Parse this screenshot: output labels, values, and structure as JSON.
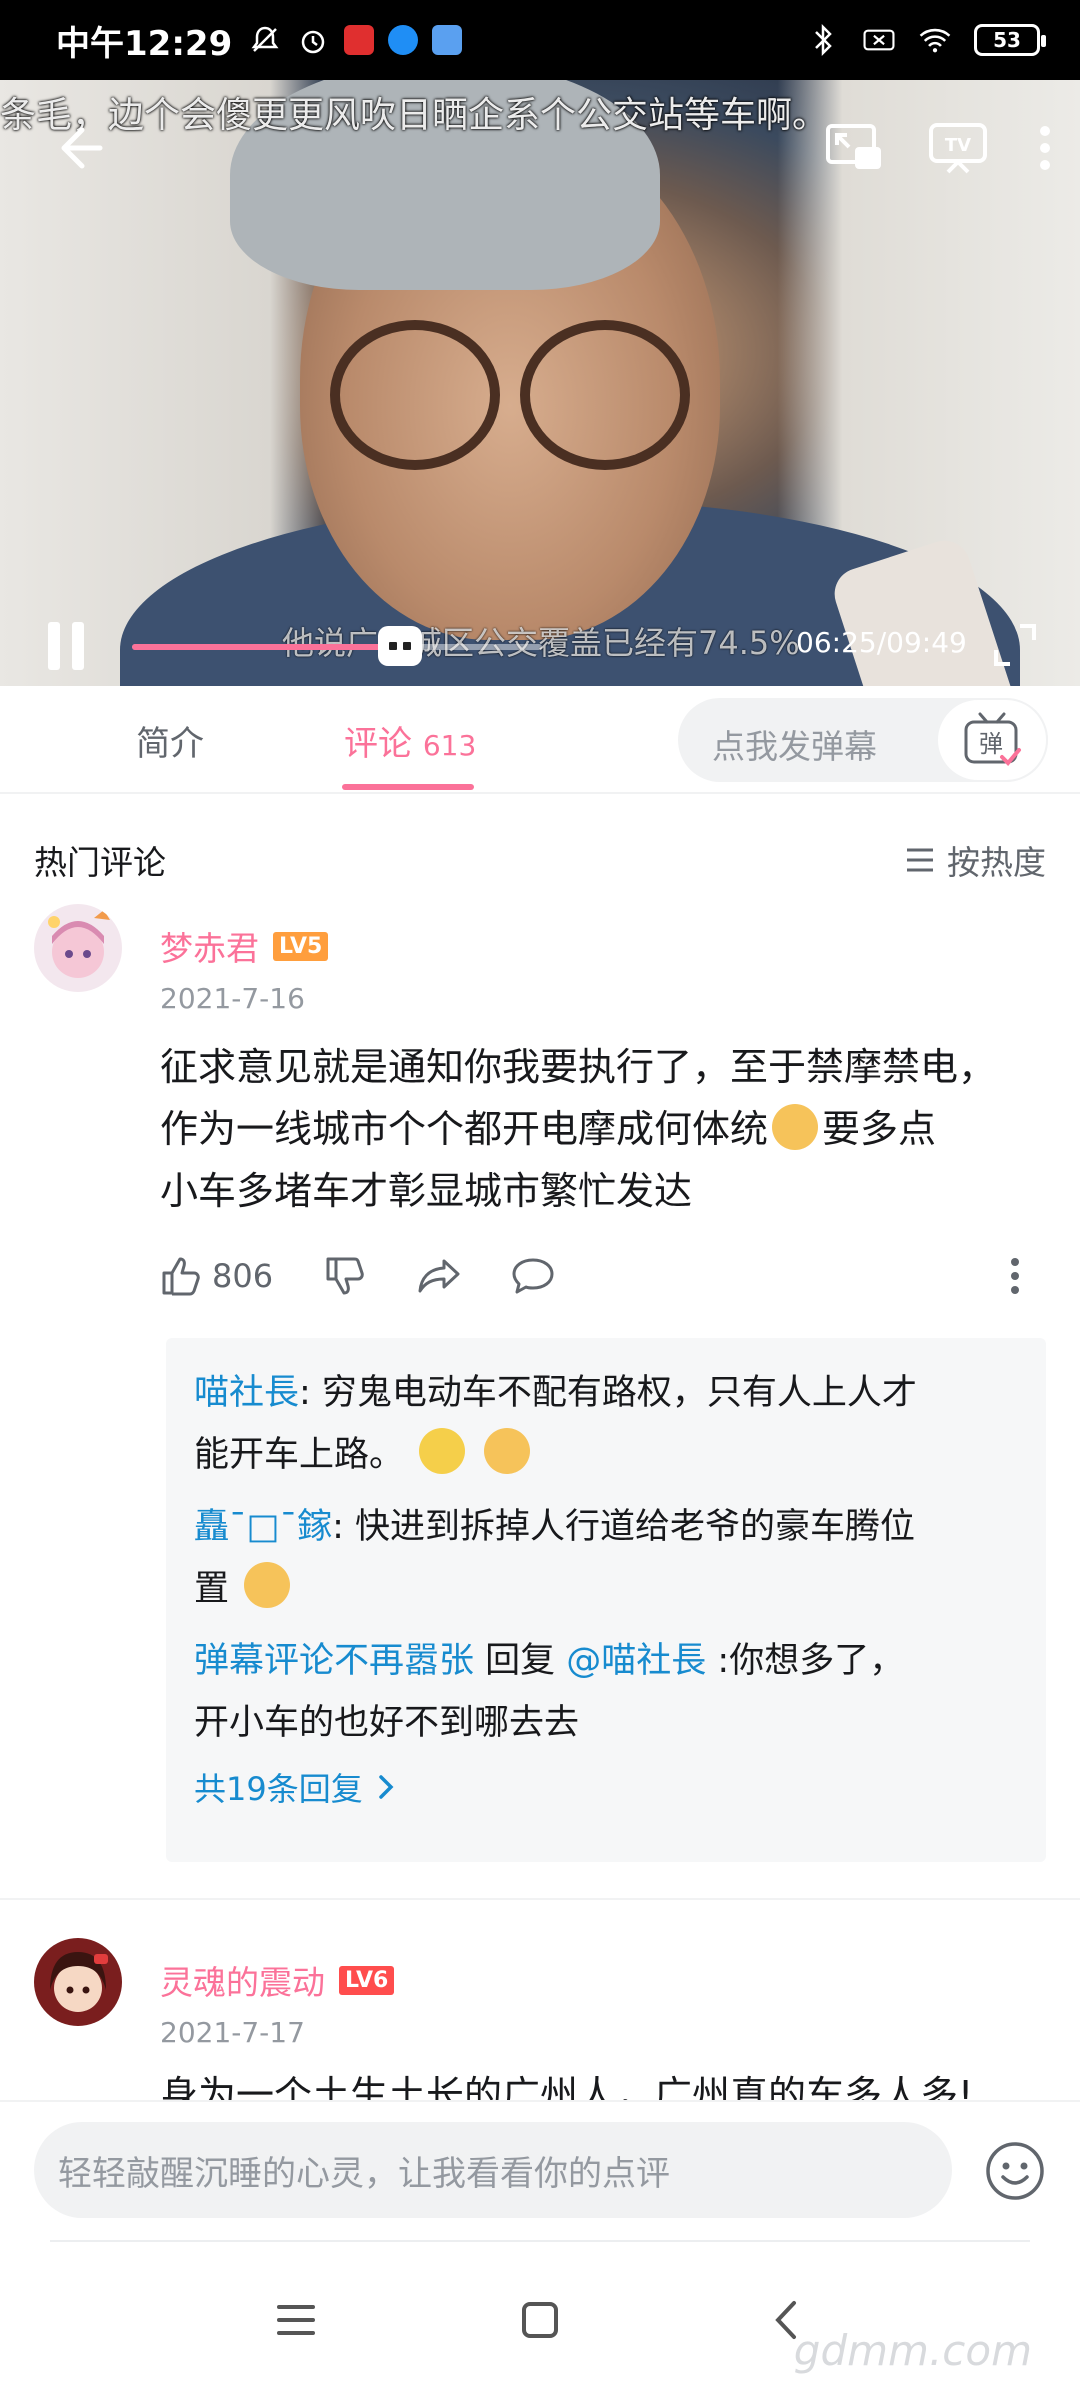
{
  "status_bar": {
    "time": "中午12:29",
    "battery": "53"
  },
  "video": {
    "danmaku_top": "条毛，边个会傻更更风吹日晒企系个公交站等车啊。",
    "danmaku_bottom": "他说广州城区公交覆盖已经有74.5%",
    "current_time": "06:25",
    "duration": "09:49",
    "time_display": "06:25/09:49",
    "progress": 0.653
  },
  "tabs": {
    "intro_label": "简介",
    "comments_label": "评论",
    "comments_count": "613"
  },
  "danmu": {
    "placeholder": "点我发弹幕",
    "button_glyph": "弹"
  },
  "comments_section": {
    "title": "热门评论",
    "sort_label": "按热度"
  },
  "comments": [
    {
      "username": "梦赤君",
      "level": "LV5",
      "date": "2021-7-16",
      "text_line1": "征求意见就是通知你我要执行了，至于禁摩禁电，",
      "text_line2a": "作为一线城市个个都开电摩成何体统",
      "text_line2b": "要多点",
      "text_line3": "小车多堵车才彰显城市繁忙发达",
      "likes": "806",
      "replies": [
        {
          "name": "喵社長",
          "text_line1": ": 穷鬼电动车不配有路权，只有人上人才",
          "text_line2": "能开车上路。"
        },
        {
          "name": "矗¯□¯鎵",
          "text_line1": ": 快进到拆掉人行道给老爷的豪车腾位",
          "text_line2": "置"
        },
        {
          "name": "弹幕评论不再嚣张",
          "reply_word": " 回复 ",
          "mention": "@喵社長",
          "text_line1": " :你想多了，",
          "text_line2": "开小车的也好不到哪去去"
        }
      ],
      "more_replies": "共19条回复"
    },
    {
      "username": "灵魂的震动",
      "level": "LV6",
      "date": "2021-7-17",
      "text_line1": "身为一个土生土长的广州人，广州真的车多人多!"
    }
  ],
  "comment_input": {
    "placeholder": "轻轻敲醒沉睡的心灵，让我看看你的点评"
  },
  "watermark": "gdmm.com",
  "colors": {
    "accent": "#fb7299",
    "link": "#178bcf",
    "level5": "#ff9e3d",
    "level6": "#ff4d4d"
  }
}
